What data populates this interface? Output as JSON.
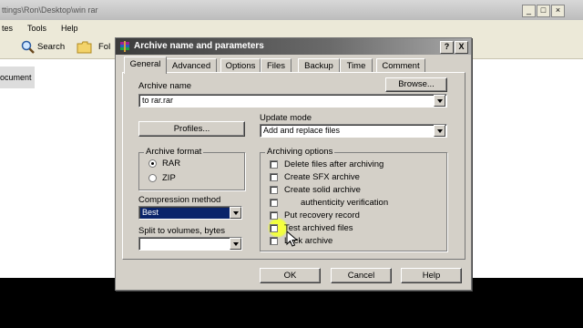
{
  "explorer": {
    "title_path": "ttings\\Ron\\Desktop\\win rar",
    "menu": [
      "tes",
      "Tools",
      "Help"
    ],
    "toolbar": {
      "search_label": "Search",
      "folders_label": "Fol"
    },
    "item_label": "ocument"
  },
  "dialog": {
    "title": "Archive name and parameters",
    "help_btn": "?",
    "close_btn": "X",
    "tabs": [
      "General",
      "Advanced",
      "Options",
      "Files",
      "Backup",
      "Time",
      "Comment"
    ],
    "active_tab": "General",
    "archive_name_label": "Archive name",
    "archive_name_value": "to rar.rar",
    "browse_label": "Browse...",
    "profiles_label": "Profiles...",
    "update_mode_label": "Update mode",
    "update_mode_value": "Add and replace files",
    "archive_format_label": "Archive format",
    "format_options": [
      "RAR",
      "ZIP"
    ],
    "format_selected": "RAR",
    "compression_label": "Compression method",
    "compression_value": "Best",
    "split_label": "Split to volumes, bytes",
    "split_value": "",
    "archiving_options_label": "Archiving options",
    "options": [
      {
        "label": "Delete files after archiving",
        "checked": false
      },
      {
        "label": "Create SFX archive",
        "checked": false
      },
      {
        "label": "Create solid archive",
        "checked": false
      },
      {
        "label": "authenticity verification",
        "checked": false
      },
      {
        "label": "Put recovery record",
        "checked": false
      },
      {
        "label": "Test archived files",
        "checked": false
      },
      {
        "label": "Lock archive",
        "checked": false
      }
    ],
    "ok_label": "OK",
    "cancel_label": "Cancel",
    "help_label": "Help"
  },
  "colors": {
    "title_bar": "#3b3b3b",
    "dialog_bg": "#d4d0c8",
    "selection": "#0a246a",
    "highlight": "#f0ff40"
  }
}
